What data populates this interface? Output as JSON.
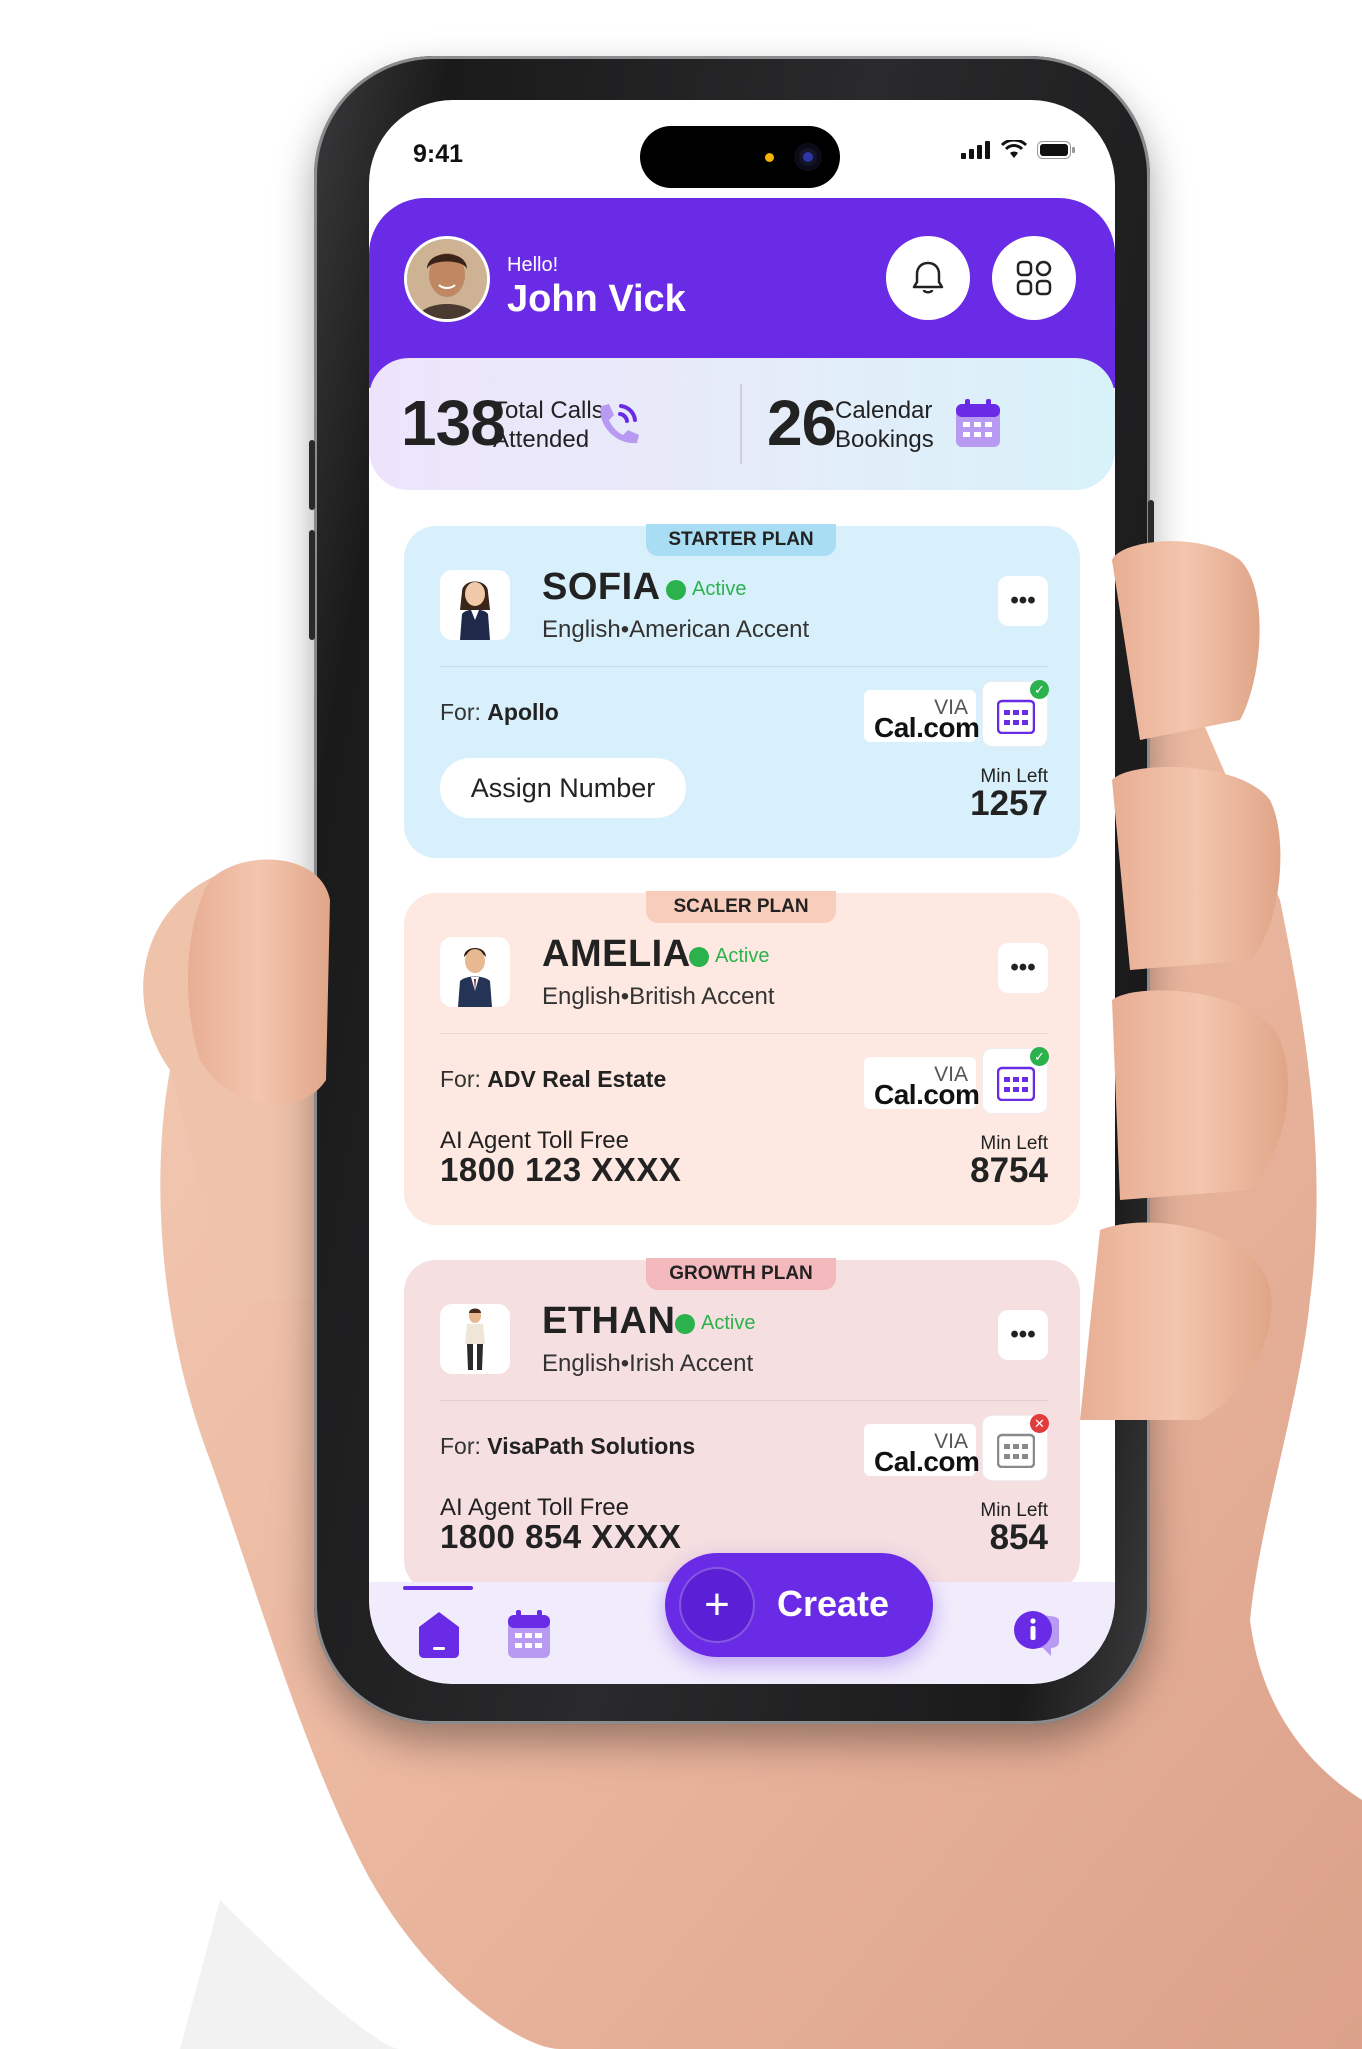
{
  "status_bar": {
    "time": "9:41"
  },
  "header": {
    "greeting": "Hello!",
    "user_name": "John Vick"
  },
  "stats": {
    "calls_count": "138",
    "calls_label_line1": "Total Calls",
    "calls_label_line2": "Attended",
    "bookings_count": "26",
    "bookings_label_line1": "Calendar",
    "bookings_label_line2": "Bookings"
  },
  "agents": [
    {
      "plan": "STARTER PLAN",
      "name": "SOFIA",
      "status": "Active",
      "language_accent": "English•American Accent",
      "for_label": "For:",
      "organization": "Apollo",
      "via": "VIA",
      "calendar_service": "Cal.com",
      "calendar_status": "connected",
      "action_label": "Assign Number",
      "min_left_label": "Min Left",
      "min_left": "1257"
    },
    {
      "plan": "SCALER PLAN",
      "name": "AMELIA",
      "status": "Active",
      "language_accent": "English•British Accent",
      "for_label": "For:",
      "organization": "ADV Real Estate",
      "via": "VIA",
      "calendar_service": "Cal.com",
      "calendar_status": "connected",
      "toll_free_label": "AI Agent Toll Free",
      "toll_free_number": "1800 123 XXXX",
      "min_left_label": "Min Left",
      "min_left": "8754"
    },
    {
      "plan": "GROWTH PLAN",
      "name": "ETHAN",
      "status": "Active",
      "language_accent": "English•Irish Accent",
      "for_label": "For:",
      "organization": "VisaPath Solutions",
      "via": "VIA",
      "calendar_service": "Cal.com",
      "calendar_status": "disconnected",
      "toll_free_label": "AI Agent Toll Free",
      "toll_free_number": "1800 854 XXXX",
      "min_left_label": "Min Left",
      "min_left": "854"
    }
  ],
  "bottom_nav": {
    "create_label": "Create",
    "icons": [
      "home-icon",
      "calendar-icon",
      "info-chat-icon"
    ]
  },
  "colors": {
    "primary": "#6a2be6",
    "active_green": "#2cb24d",
    "starter_card": "#d8f0fb",
    "starter_tag": "#a9ddf3",
    "scaler_card": "#fde9e2",
    "scaler_tag": "#f9cdbb",
    "growth_card": "#f5dfe0",
    "growth_tag": "#f3b9bd"
  }
}
